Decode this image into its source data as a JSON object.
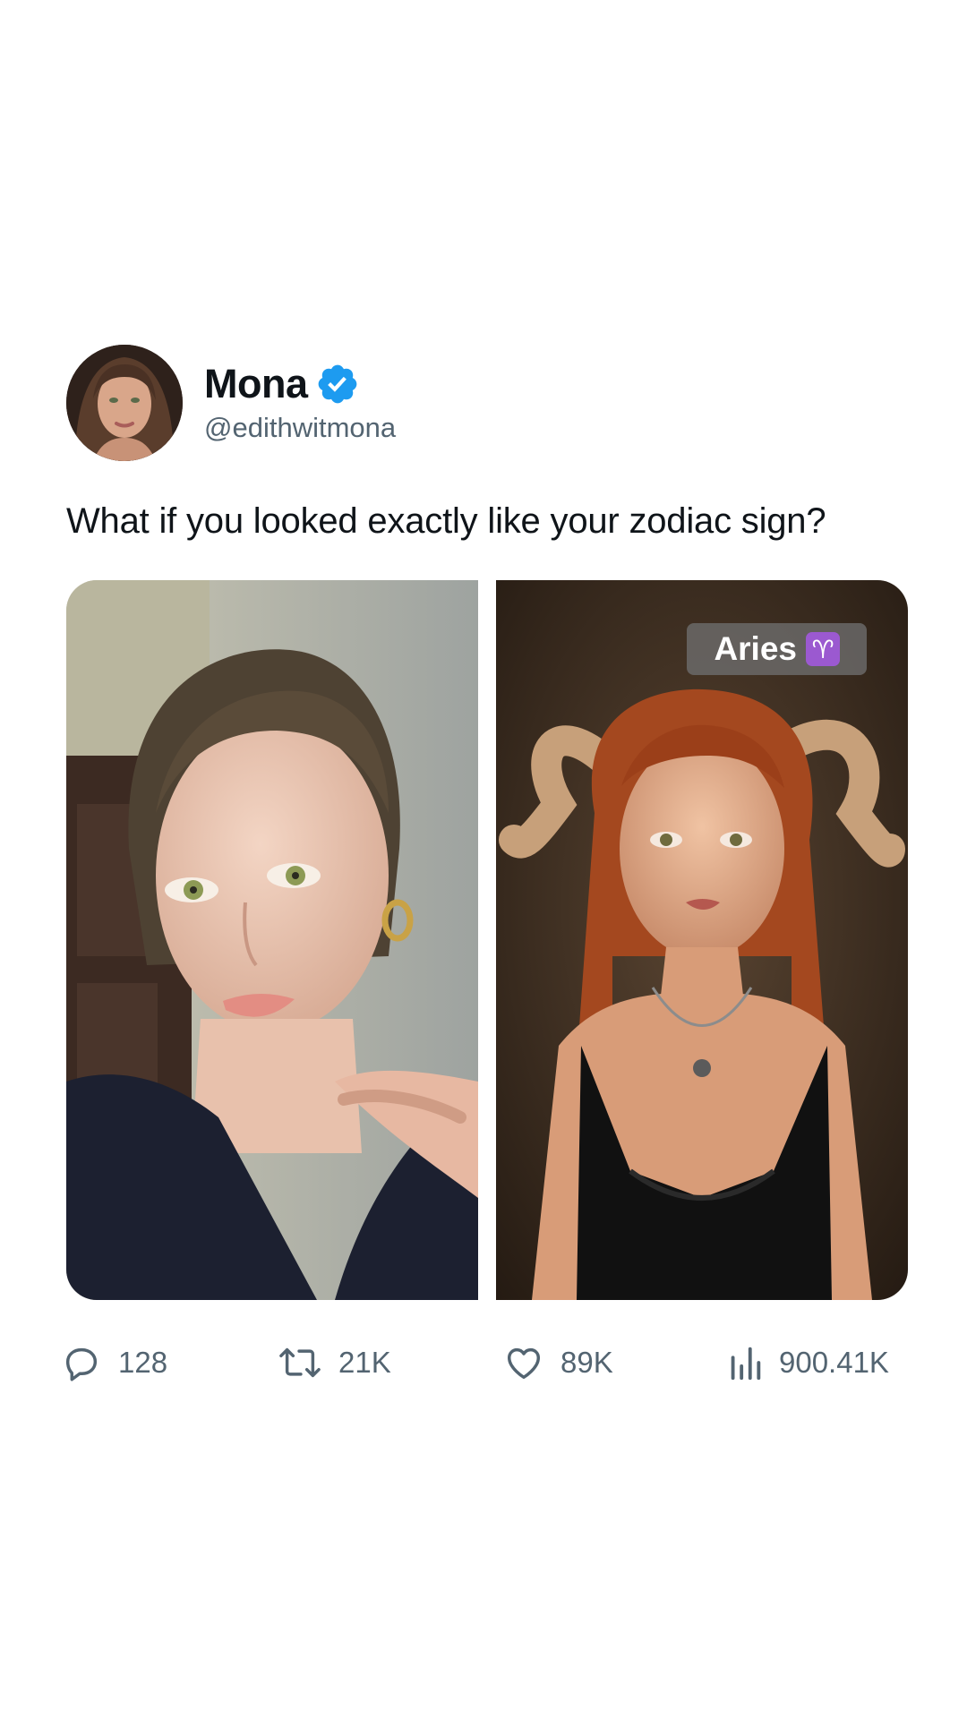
{
  "author": {
    "display_name": "Mona",
    "handle": "@edithwitmona",
    "verified": true,
    "verified_color": "#1d9bf0"
  },
  "tweet": {
    "text": "What if you looked exactly like your zodiac sign?"
  },
  "media": {
    "left_image": "photo-selfie-portrait",
    "right_image": "photo-aries-portrait",
    "badge": {
      "label": "Aries",
      "glyph": "♈"
    }
  },
  "actions": {
    "replies": "128",
    "reposts": "21K",
    "likes": "89K",
    "views": "900.41K"
  },
  "colors": {
    "text_primary": "#0f1419",
    "text_secondary": "#536471"
  }
}
